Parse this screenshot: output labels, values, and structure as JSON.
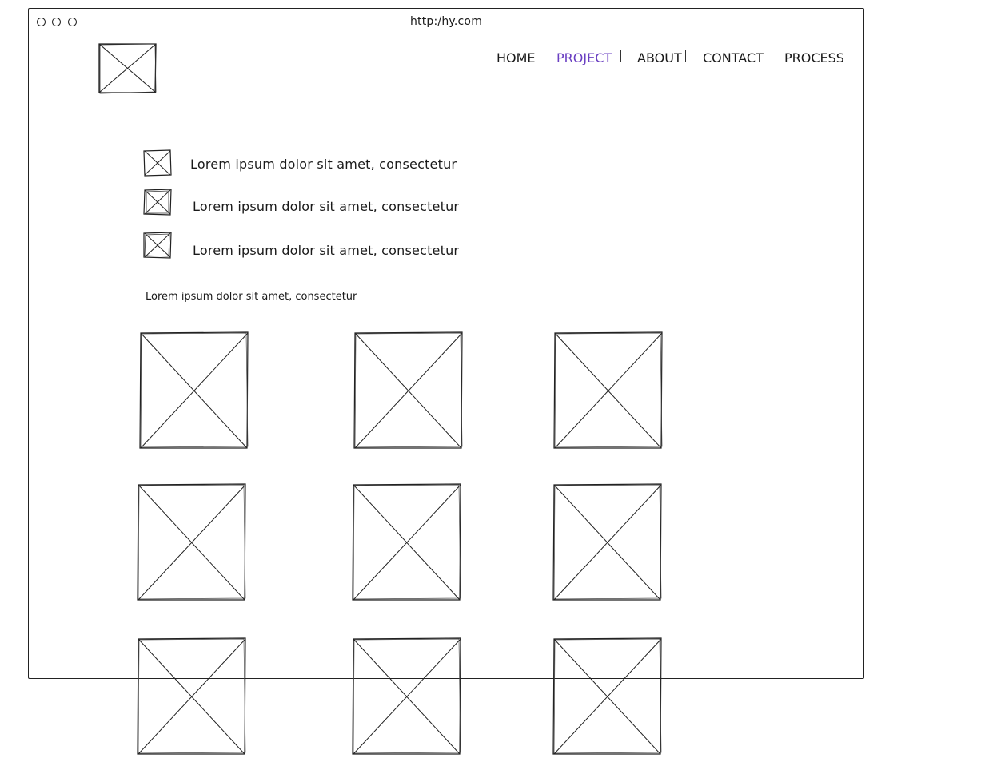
{
  "browser": {
    "url": "http:/hy.com"
  },
  "logo": {
    "icon": "image-placeholder-icon"
  },
  "nav": {
    "items": [
      {
        "label": "HOME",
        "active": false
      },
      {
        "label": "PROJECT",
        "active": true
      },
      {
        "label": "ABOUT",
        "active": false
      },
      {
        "label": "CONTACT",
        "active": false
      },
      {
        "label": "PROCESS",
        "active": false
      }
    ],
    "active_color": "#6a3fc2"
  },
  "features": [
    {
      "text": "Lorem ipsum dolor sit amet, consectetur",
      "icon": "image-placeholder-icon"
    },
    {
      "text": "Lorem ipsum dolor sit amet, consectetur",
      "icon": "image-placeholder-icon"
    },
    {
      "text": "Lorem ipsum dolor sit amet, consectetur",
      "icon": "image-placeholder-icon"
    }
  ],
  "gallery": {
    "caption": "Lorem ipsum dolor sit amet, consectetur",
    "rows": 3,
    "columns": 3,
    "item_icon": "image-placeholder-icon"
  }
}
